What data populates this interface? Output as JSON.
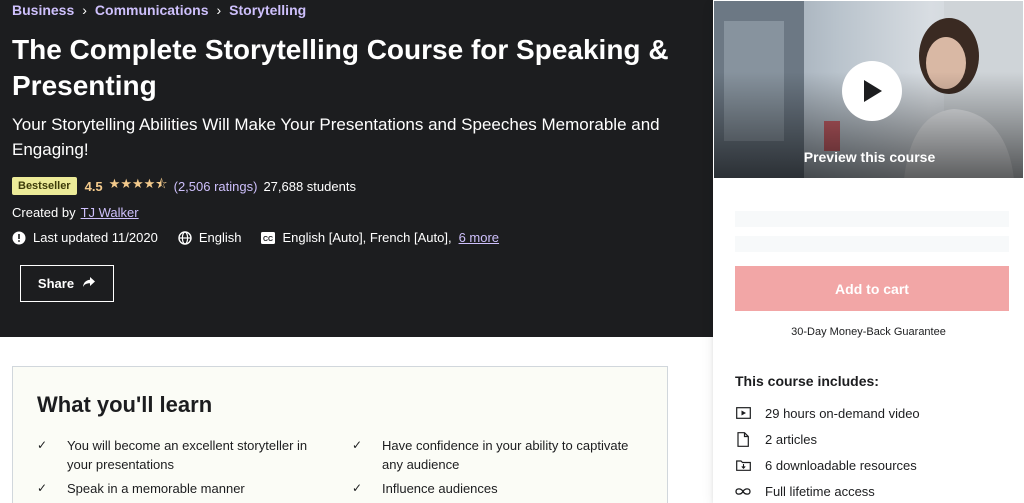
{
  "breadcrumb": [
    "Business",
    "Communications",
    "Storytelling"
  ],
  "course": {
    "title": "The Complete Storytelling Course for Speaking & Presenting",
    "subtitle": "Your Storytelling Abilities Will Make Your Presentations and Speeches Memorable and Engaging!",
    "badge": "Bestseller",
    "rating": "4.5",
    "ratings_count": "(2,506 ratings)",
    "students": "27,688 students",
    "created_by_label": "Created by",
    "instructor": "TJ Walker",
    "last_updated": "Last updated 11/2020",
    "language": "English",
    "captions": "English [Auto], French [Auto],",
    "more_captions": "6 more",
    "share_label": "Share"
  },
  "sidebar": {
    "preview_label": "Preview this course",
    "add_to_cart": "Add to cart",
    "guarantee": "30-Day Money-Back Guarantee",
    "includes_title": "This course includes:",
    "includes": [
      {
        "icon": "video-icon",
        "text": "29 hours on-demand video"
      },
      {
        "icon": "file-icon",
        "text": "2 articles"
      },
      {
        "icon": "download-icon",
        "text": "6 downloadable resources"
      },
      {
        "icon": "infinity-icon",
        "text": "Full lifetime access"
      }
    ]
  },
  "learn": {
    "title": "What you'll learn",
    "items": [
      "You will become an excellent storyteller in your presentations",
      "Have confidence in your ability to captivate any audience",
      "Speak in a memorable manner",
      "Influence audiences"
    ]
  },
  "colors": {
    "hero_bg": "#1c1d1f",
    "link_purple": "#cec0fc",
    "star_gold": "#f3ca8c",
    "badge_bg": "#eceb98",
    "add_cart_bg": "#f2a6a6"
  }
}
